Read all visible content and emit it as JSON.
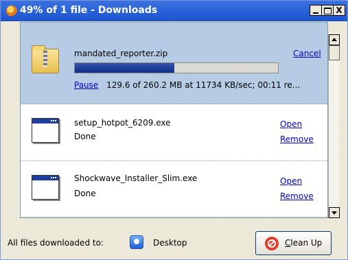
{
  "window": {
    "title": "49% of 1 file - Downloads",
    "controls": {
      "minimize": "_",
      "maximize": "□",
      "close": "X"
    }
  },
  "downloads": [
    {
      "filename": "mandated_reporter.zip",
      "action": "Cancel",
      "progress_percent": 49,
      "pause_label": "Pause",
      "transfer_text": "129.6 of 260.2 MB at 11734 KB/sec; 00:11 re...",
      "icon": "zip-folder-icon",
      "selected": true
    },
    {
      "filename": "setup_hotpot_6209.exe",
      "status": "Done",
      "open_label": "Open",
      "remove_label": "Remove",
      "icon": "application-window-icon"
    },
    {
      "filename": "Shockwave_Installer_Slim.exe",
      "status": "Done",
      "open_label": "Open",
      "remove_label": "Remove",
      "icon": "application-window-icon"
    }
  ],
  "footer": {
    "label": "All files downloaded to:",
    "location": "Desktop",
    "location_icon": "desktop-icon",
    "cleanup_label": "Clean Up",
    "cleanup_icon": "no-entry-icon"
  },
  "colors": {
    "titlebar": "#1b53cf",
    "selected_row": "#b6cbe4",
    "progress_fill": "#0d2f8a",
    "link": "#0000cc"
  }
}
